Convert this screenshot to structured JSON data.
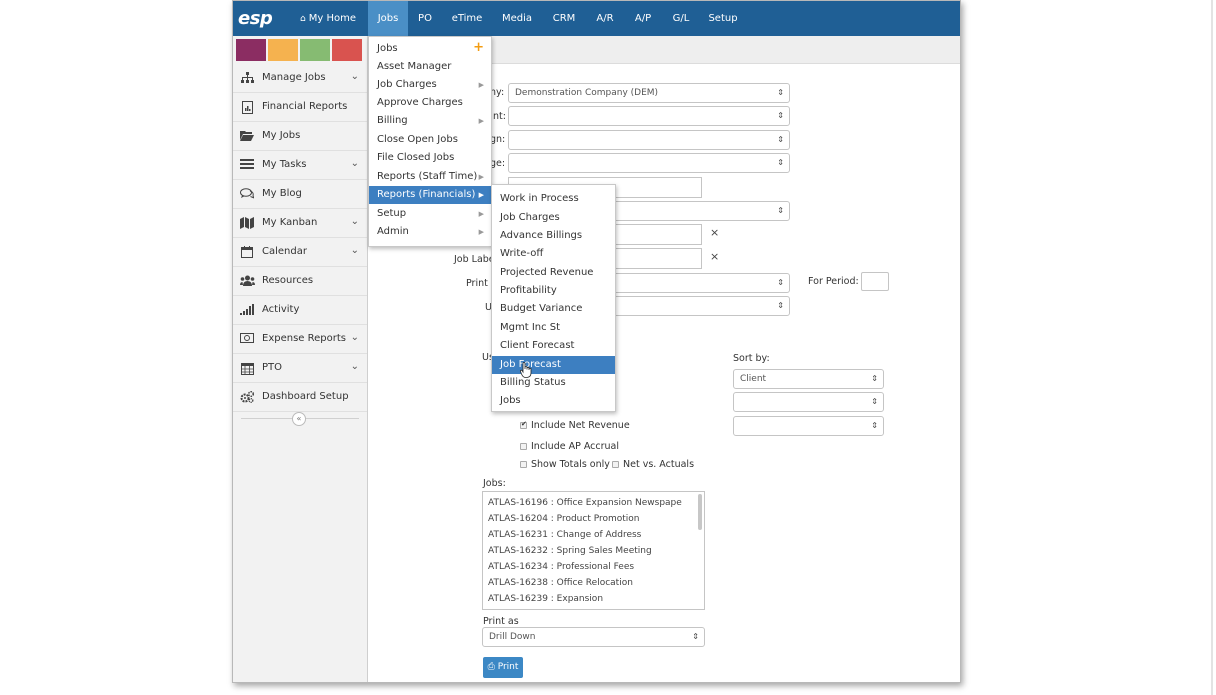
{
  "app": {
    "logo": "esp"
  },
  "topnav": {
    "items": [
      {
        "label": "My Home",
        "icon": "home-icon"
      },
      {
        "label": "Jobs",
        "active": true
      },
      {
        "label": "PO"
      },
      {
        "label": "eTime"
      },
      {
        "label": "Media"
      },
      {
        "label": "CRM"
      },
      {
        "label": "A/R"
      },
      {
        "label": "A/P"
      },
      {
        "label": "G/L"
      },
      {
        "label": "Setup"
      }
    ]
  },
  "colors": {
    "nav": "#1f5f95",
    "nav_active": "#4a8fc6",
    "menu_highlight": "#3d7fc1",
    "swatches": [
      "#8b2d62",
      "#f5b24f",
      "#86bb72",
      "#d9534f"
    ]
  },
  "sidebar": {
    "items": [
      {
        "label": "Manage Jobs",
        "icon": "sitemap-icon",
        "expandable": true
      },
      {
        "label": "Financial Reports",
        "icon": "report-icon",
        "expandable": false
      },
      {
        "label": "My Jobs",
        "icon": "folder-open-icon",
        "expandable": false
      },
      {
        "label": "My Tasks",
        "icon": "tasks-icon",
        "expandable": true
      },
      {
        "label": "My Blog",
        "icon": "comments-icon",
        "expandable": false
      },
      {
        "label": "My Kanban",
        "icon": "map-icon",
        "expandable": true
      },
      {
        "label": "Calendar",
        "icon": "calendar-icon",
        "expandable": true
      },
      {
        "label": "Resources",
        "icon": "users-icon",
        "expandable": false
      },
      {
        "label": "Activity",
        "icon": "signal-icon",
        "expandable": false
      },
      {
        "label": "Expense Reports",
        "icon": "money-icon",
        "expandable": true
      },
      {
        "label": "PTO",
        "icon": "calendar-grid-icon",
        "expandable": true
      },
      {
        "label": "Dashboard Setup",
        "icon": "cogs-icon",
        "expandable": false
      }
    ],
    "collapse_label": "«"
  },
  "jobs_menu": {
    "items": [
      {
        "label": "Jobs",
        "plus": "+"
      },
      {
        "label": "Asset Manager"
      },
      {
        "label": "Job Charges",
        "submenu": true
      },
      {
        "label": "Approve Charges"
      },
      {
        "label": "Billing",
        "submenu": true
      },
      {
        "label": "Close Open Jobs"
      },
      {
        "label": "File Closed Jobs"
      },
      {
        "label": "Reports (Staff Time)",
        "submenu": true
      },
      {
        "label": "Reports (Financials)",
        "submenu": true,
        "active": true
      },
      {
        "label": "Setup",
        "submenu": true
      },
      {
        "label": "Admin",
        "submenu": true
      }
    ]
  },
  "financials_submenu": {
    "items": [
      {
        "label": "Work in Process"
      },
      {
        "label": "Job Charges"
      },
      {
        "label": "Advance Billings"
      },
      {
        "label": "Write-off"
      },
      {
        "label": "Projected Revenue"
      },
      {
        "label": "Profitability"
      },
      {
        "label": "Budget Variance"
      },
      {
        "label": "Mgmt Inc St"
      },
      {
        "label": "Client Forecast"
      },
      {
        "label": "Job Forecast",
        "active": true
      },
      {
        "label": "Billing Status"
      },
      {
        "label": "Jobs"
      }
    ]
  },
  "form": {
    "company_label_partial": "ny:",
    "company_value": "Demonstration Company (DEM)",
    "client_label_partial": "nt:",
    "campaign_label_partial": "gn:",
    "stage_label_partial": "ge:",
    "job_label_partial": "Job Labe",
    "print_label_partial": "Print f",
    "use_label_partial": "U",
    "use2_label_partial": "Us",
    "clear_symbol": "×",
    "for_period_label": "For Period:",
    "sort_by_label": "Sort by:",
    "sort_by_values": [
      "Client",
      "",
      ""
    ],
    "include_net_revenue": {
      "label": "Include Net Revenue",
      "checked": true
    },
    "include_ap_accrual": {
      "label": "Include AP Accrual",
      "checked": false
    },
    "show_totals_only": {
      "label": "Show Totals only",
      "checked": false
    },
    "net_vs_actuals": {
      "label": "Net vs. Actuals",
      "checked": false
    },
    "jobs_label": "Jobs:",
    "jobs": [
      "ATLAS-16196 : Office Expansion Newspape",
      "ATLAS-16204 : Product Promotion",
      "ATLAS-16231 : Change of Address",
      "ATLAS-16232 : Spring Sales Meeting",
      "ATLAS-16234 : Professional Fees",
      "ATLAS-16238 : Office Relocation",
      "ATLAS-16239 : Expansion"
    ],
    "print_as_label": "Print as",
    "print_as_value": "Drill Down",
    "print_button": "Print"
  }
}
